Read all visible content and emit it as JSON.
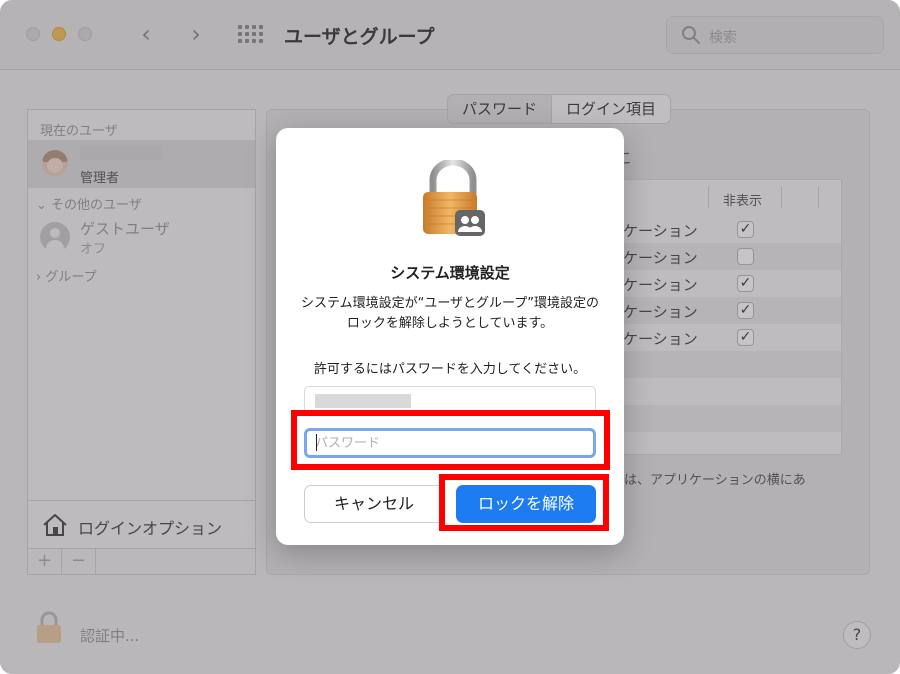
{
  "window": {
    "title": "ユーザとグループ",
    "search_placeholder": "検索"
  },
  "sidebar": {
    "current_heading": "現在のユーザ",
    "current_user_role": "管理者",
    "other_heading": "その他のユーザ",
    "guest_name": "ゲストユーザ",
    "guest_status": "オフ",
    "group_label": "グループ",
    "login_options": "ログインオプション",
    "add_label": "+",
    "remove_label": "−"
  },
  "tabs": [
    {
      "label": "パスワード"
    },
    {
      "label": "ログイン項目"
    }
  ],
  "login_items": {
    "header_fragment": "こ",
    "hide_column": "非表示",
    "rows": [
      {
        "text": "ケーション",
        "checked": true
      },
      {
        "text": "ケーション",
        "checked": false
      },
      {
        "text": "ケーション",
        "checked": true
      },
      {
        "text": "ケーション",
        "checked": true
      },
      {
        "text": "ケーション",
        "checked": true
      }
    ],
    "footer_fragment": "は、アプリケーションの横にあ"
  },
  "bottom": {
    "auth_status": "認証中...",
    "help_label": "?"
  },
  "dialog": {
    "title": "システム環境設定",
    "message": "システム環境設定が“ユーザとグループ”環境設定のロックを解除しようとしています。",
    "prompt": "許可するにはパスワードを入力してください。",
    "password_placeholder": "パスワード",
    "cancel_label": "キャンセル",
    "unlock_label": "ロックを解除"
  },
  "colors": {
    "accent": "#1d7cf2",
    "highlight": "#ff0000",
    "focus_ring": "#79a6f0"
  }
}
